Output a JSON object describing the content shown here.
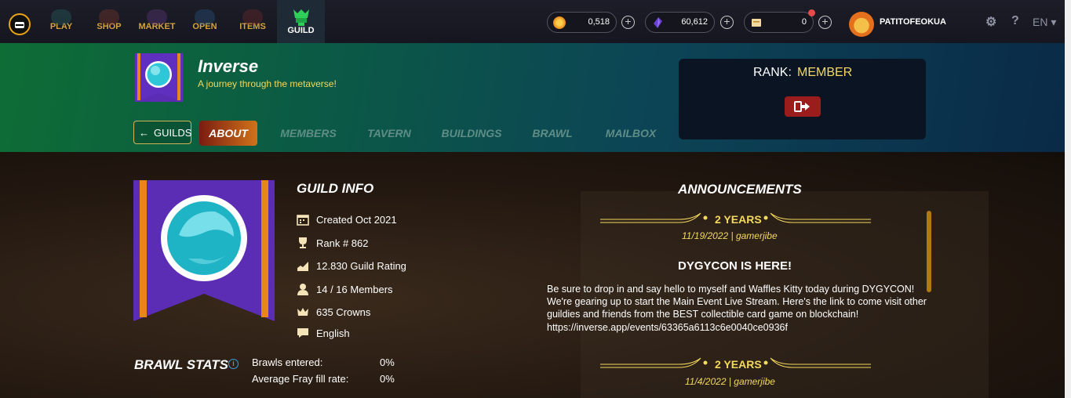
{
  "nav": {
    "items": [
      {
        "label": "PLAY"
      },
      {
        "label": "SHOP"
      },
      {
        "label": "MARKET"
      },
      {
        "label": "OPEN"
      },
      {
        "label": "ITEMS"
      },
      {
        "label": "GUILD"
      }
    ]
  },
  "currency": {
    "credits": "0,518",
    "dec": "60,612",
    "vouchers": "0"
  },
  "user": {
    "name": "PATITOFEOKUA"
  },
  "lang": "EN",
  "guild": {
    "name": "Inverse",
    "motto": "A journey through the metaverse!",
    "back_label": "GUILDS",
    "tabs": [
      "ABOUT",
      "MEMBERS",
      "TAVERN",
      "BUILDINGS",
      "BRAWL",
      "MAILBOX"
    ],
    "rank_label": "RANK:",
    "rank_value": "MEMBER"
  },
  "guild_info": {
    "title": "GUILD INFO",
    "created": "Created Oct 2021",
    "rank": "Rank # 862",
    "rating": "12.830 Guild Rating",
    "members": "14 / 16 Members",
    "crowns": "635 Crowns",
    "language": "English"
  },
  "brawl_stats": {
    "title": "BRAWL STATS",
    "rows": [
      {
        "label": "Brawls entered:",
        "value": "0%"
      },
      {
        "label": "Average Fray fill rate:",
        "value": "0%"
      }
    ]
  },
  "announcements": {
    "title": "ANNOUNCEMENTS",
    "items": [
      {
        "badge": "2 YEARS",
        "meta": "11/19/2022 | gamerjibe",
        "heading": "DYGYCON IS HERE!",
        "body": "Be sure to drop in and say hello to myself and Waffles Kitty today during DYGYCON! We're gearing up to start the Main Event Live Stream. Here's the link to come visit other guildies and friends from the BEST collectible card game on blockchain! https://inverse.app/events/63365a6113c6e0040ce0936f"
      },
      {
        "badge": "2 YEARS",
        "meta": "11/4/2022 | gamerjibe"
      }
    ]
  },
  "colors": {
    "accent_gold": "#f3d95f",
    "tab_active": "#d1731a",
    "leave_red": "#9b1c1c"
  }
}
